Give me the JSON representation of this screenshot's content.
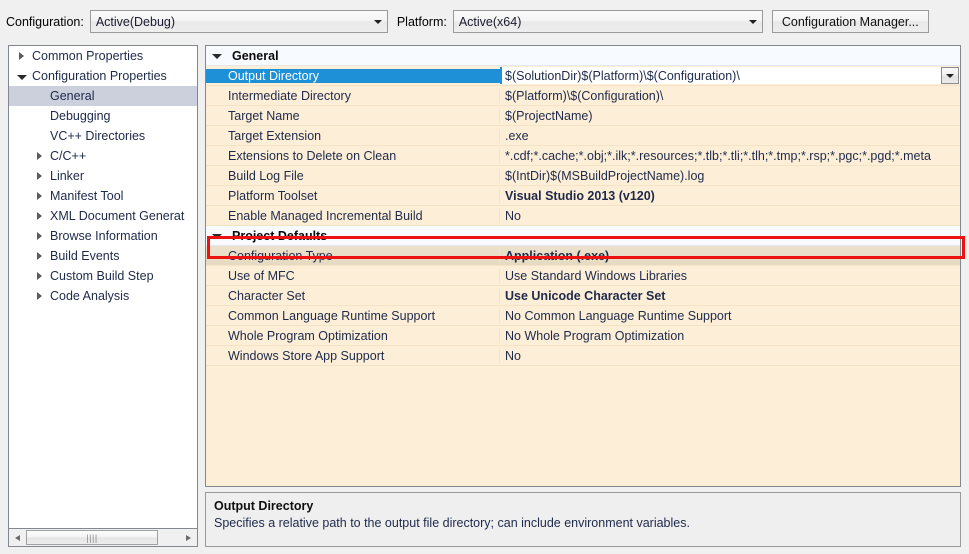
{
  "toolbar": {
    "configuration_label": "Configuration:",
    "configuration_value": "Active(Debug)",
    "platform_label": "Platform:",
    "platform_value": "Active(x64)",
    "configuration_manager_label": "Configuration Manager..."
  },
  "tree": {
    "items": [
      {
        "label": "Common Properties",
        "indent": 0,
        "twisty": "collapsed",
        "selected": false
      },
      {
        "label": "Configuration Properties",
        "indent": 0,
        "twisty": "expanded",
        "selected": false
      },
      {
        "label": "General",
        "indent": 1,
        "twisty": "none",
        "selected": true
      },
      {
        "label": "Debugging",
        "indent": 1,
        "twisty": "none",
        "selected": false
      },
      {
        "label": "VC++ Directories",
        "indent": 1,
        "twisty": "none",
        "selected": false
      },
      {
        "label": "C/C++",
        "indent": 1,
        "twisty": "collapsed",
        "selected": false
      },
      {
        "label": "Linker",
        "indent": 1,
        "twisty": "collapsed",
        "selected": false
      },
      {
        "label": "Manifest Tool",
        "indent": 1,
        "twisty": "collapsed",
        "selected": false
      },
      {
        "label": "XML Document Generat",
        "indent": 1,
        "twisty": "collapsed",
        "selected": false
      },
      {
        "label": "Browse Information",
        "indent": 1,
        "twisty": "collapsed",
        "selected": false
      },
      {
        "label": "Build Events",
        "indent": 1,
        "twisty": "collapsed",
        "selected": false
      },
      {
        "label": "Custom Build Step",
        "indent": 1,
        "twisty": "collapsed",
        "selected": false
      },
      {
        "label": "Code Analysis",
        "indent": 1,
        "twisty": "collapsed",
        "selected": false
      }
    ],
    "scrollbar": {
      "left_arrow": "left-arrow",
      "right_arrow": "right-arrow",
      "grip": "||||"
    }
  },
  "grid": {
    "rows": [
      {
        "kind": "category",
        "label": "General"
      },
      {
        "kind": "property",
        "name": "Output Directory",
        "value": "$(SolutionDir)$(Platform)\\$(Configuration)\\",
        "bold": false,
        "selected": true
      },
      {
        "kind": "property",
        "name": "Intermediate Directory",
        "value": "$(Platform)\\$(Configuration)\\",
        "bold": false,
        "selected": false
      },
      {
        "kind": "property",
        "name": "Target Name",
        "value": "$(ProjectName)",
        "bold": false,
        "selected": false
      },
      {
        "kind": "property",
        "name": "Target Extension",
        "value": ".exe",
        "bold": false,
        "selected": false
      },
      {
        "kind": "property",
        "name": "Extensions to Delete on Clean",
        "value": "*.cdf;*.cache;*.obj;*.ilk;*.resources;*.tlb;*.tli;*.tlh;*.tmp;*.rsp;*.pgc;*.pgd;*.meta",
        "bold": false,
        "selected": false
      },
      {
        "kind": "property",
        "name": "Build Log File",
        "value": "$(IntDir)$(MSBuildProjectName).log",
        "bold": false,
        "selected": false
      },
      {
        "kind": "property",
        "name": "Platform Toolset",
        "value": "Visual Studio 2013 (v120)",
        "bold": true,
        "selected": false
      },
      {
        "kind": "property",
        "name": "Enable Managed Incremental Build",
        "value": "No",
        "bold": false,
        "selected": false
      },
      {
        "kind": "category",
        "label": "Project Defaults"
      },
      {
        "kind": "property",
        "name": "Configuration Type",
        "value": "Application (.exe)",
        "bold": true,
        "selected": false,
        "highlighted": true
      },
      {
        "kind": "property",
        "name": "Use of MFC",
        "value": "Use Standard Windows Libraries",
        "bold": false,
        "selected": false
      },
      {
        "kind": "property",
        "name": "Character Set",
        "value": "Use Unicode Character Set",
        "bold": true,
        "selected": false
      },
      {
        "kind": "property",
        "name": "Common Language Runtime Support",
        "value": "No Common Language Runtime Support",
        "bold": false,
        "selected": false
      },
      {
        "kind": "property",
        "name": "Whole Program Optimization",
        "value": "No Whole Program Optimization",
        "bold": false,
        "selected": false
      },
      {
        "kind": "property",
        "name": "Windows Store App Support",
        "value": "No",
        "bold": false,
        "selected": false
      }
    ]
  },
  "description": {
    "title": "Output Directory",
    "text": "Specifies a relative path to the output file directory; can include environment variables."
  },
  "colors": {
    "selection_blue": "#1e90d8",
    "grid_background": "#fdeed8",
    "annotation_red": "#ee1111",
    "tree_selection": "#ccd0dd"
  }
}
